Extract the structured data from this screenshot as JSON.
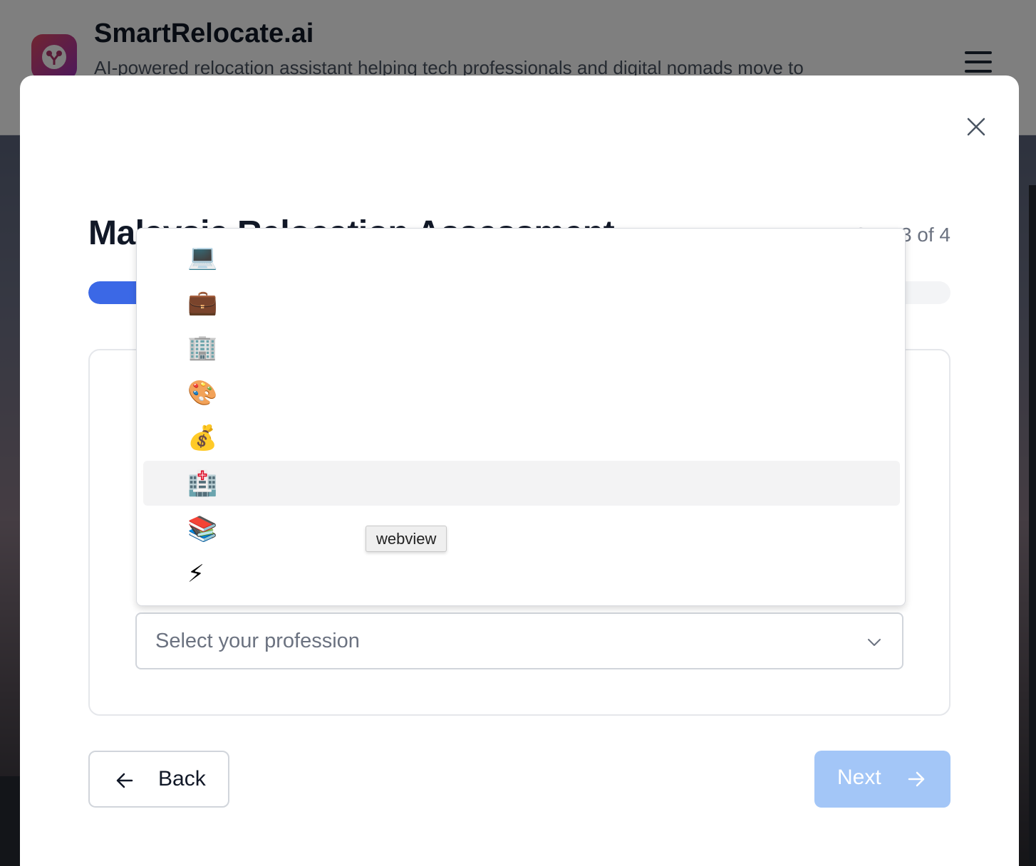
{
  "header": {
    "title": "SmartRelocate.ai",
    "subtitle": "AI-powered relocation assistant helping tech professionals and digital nomads move to"
  },
  "modal": {
    "title": "Malaysia Relocation Assessment",
    "step_text": "Step 3 of 4",
    "progress_percent": 75
  },
  "profession_select": {
    "placeholder": "Select your profession",
    "options": [
      {
        "emoji": "💻",
        "icon": "laptop-icon"
      },
      {
        "emoji": "💼",
        "icon": "briefcase-icon"
      },
      {
        "emoji": "🏢",
        "icon": "office-building-icon"
      },
      {
        "emoji": "🎨",
        "icon": "artist-palette-icon"
      },
      {
        "emoji": "💰",
        "icon": "money-bag-icon"
      },
      {
        "emoji": "🏥",
        "icon": "hospital-icon"
      },
      {
        "emoji": "📚",
        "icon": "books-icon"
      },
      {
        "emoji": "⚡",
        "icon": "lightning-icon"
      }
    ],
    "highlighted_index": 5
  },
  "buttons": {
    "back_label": "Back",
    "next_label": "Next"
  },
  "tooltip": "webview",
  "colors": {
    "accent": "#3b68e6",
    "next_disabled": "#a3c6f7"
  }
}
